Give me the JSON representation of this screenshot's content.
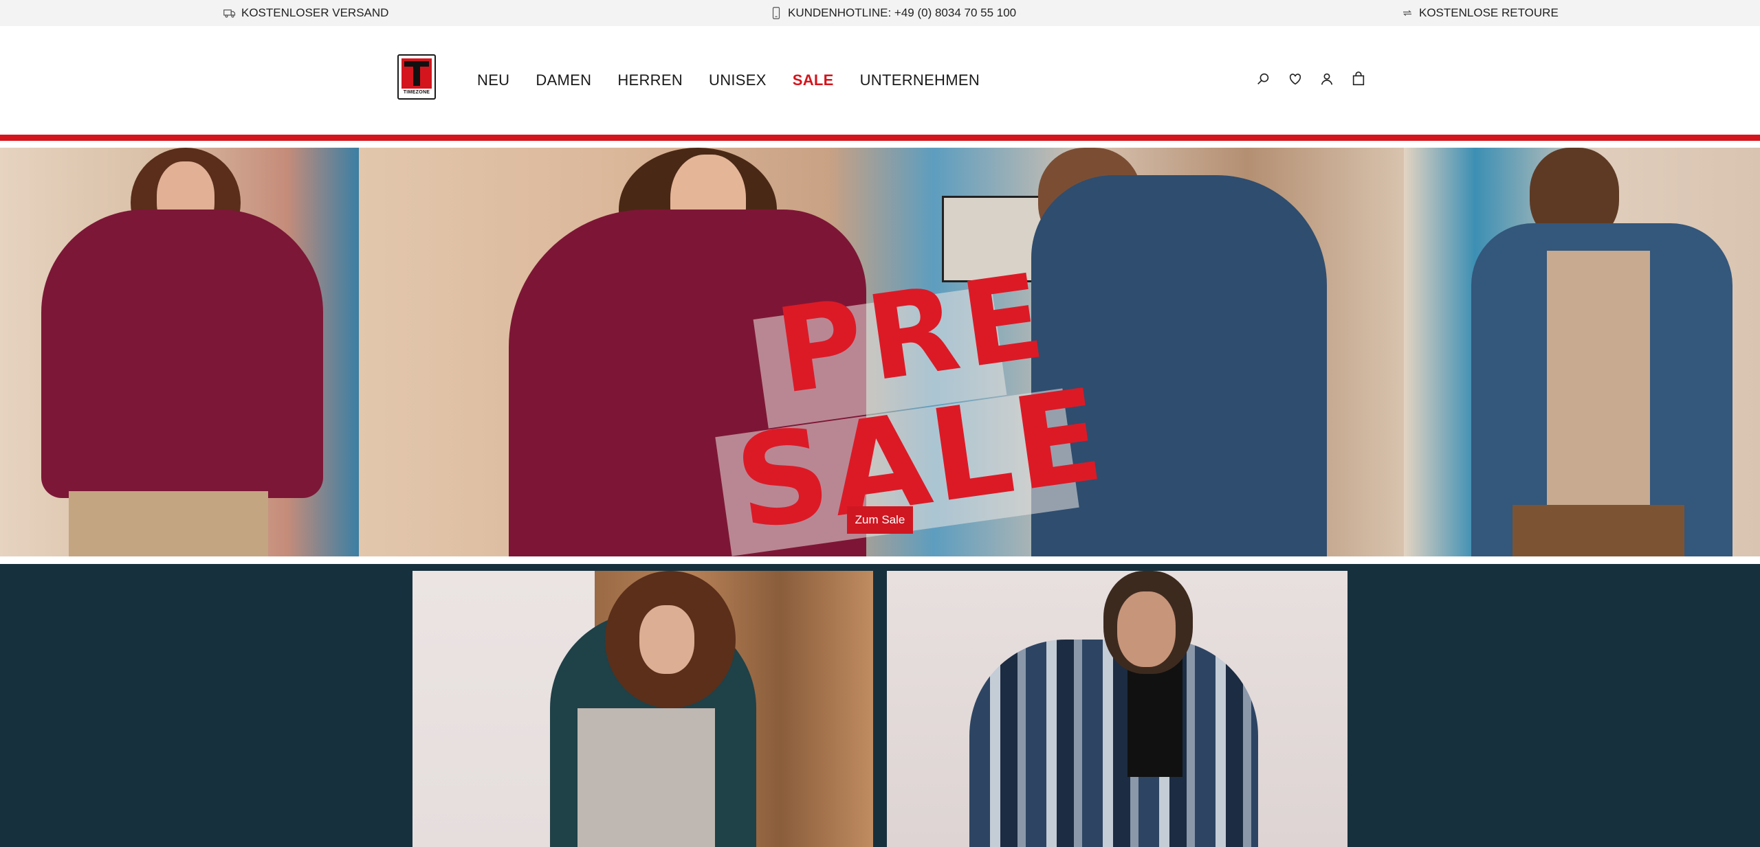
{
  "topbar": {
    "shipping": {
      "label": "KOSTENLOSER VERSAND",
      "icon": "truck-icon"
    },
    "hotline": {
      "label": "KUNDENHOTLINE: +49 (0) 8034 70 55 100",
      "icon": "phone-icon"
    },
    "returns": {
      "label": "KOSTENLOSE RETOURE",
      "icon": "return-arrows-icon"
    }
  },
  "header": {
    "logo_text": "TIMEZONE",
    "nav": [
      {
        "label": "NEU"
      },
      {
        "label": "DAMEN"
      },
      {
        "label": "HERREN"
      },
      {
        "label": "UNISEX"
      },
      {
        "label": "SALE",
        "highlight": "#d4151d"
      },
      {
        "label": "UNTERNEHMEN"
      }
    ],
    "actions": [
      "search-icon",
      "heart-icon",
      "user-icon",
      "bag-icon"
    ]
  },
  "hero": {
    "headline_line1": "PRE",
    "headline_line2": "SALE",
    "cta_label": "Zum Sale"
  },
  "colors": {
    "brand_red": "#d4151d",
    "dark_teal": "#17303d",
    "topbar_bg": "#f3f3f3"
  }
}
